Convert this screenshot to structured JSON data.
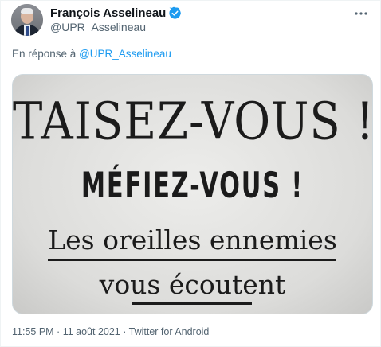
{
  "author": {
    "display_name": "François Asselineau",
    "handle": "@UPR_Asselineau",
    "verified": true,
    "verified_color": "#1d9bf0"
  },
  "reply": {
    "prefix": "En réponse à",
    "mention": "@UPR_Asselineau"
  },
  "media": {
    "line1": "TAISEZ-VOUS !",
    "line2": "MÉFIEZ-VOUS !",
    "line3": "Les oreilles ennemies",
    "line4": "vous écoutent"
  },
  "meta": {
    "time": "11:55 PM",
    "separator": " · ",
    "date": "11 août 2021",
    "source": "Twitter for Android"
  },
  "icons": {
    "more": "more-horizontal-icon",
    "verified": "verified-badge-icon"
  }
}
